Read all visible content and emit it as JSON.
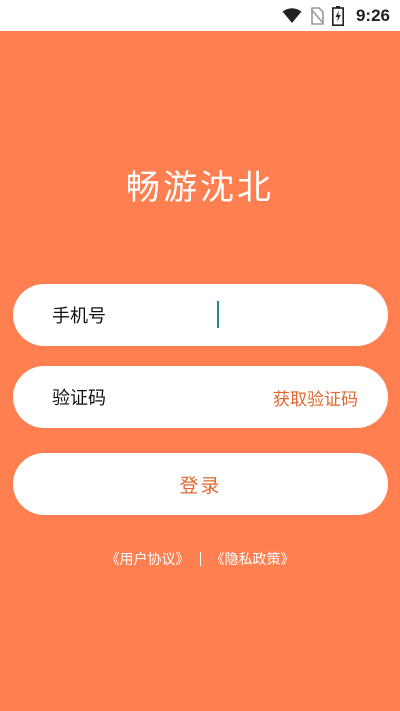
{
  "status_bar": {
    "time": "9:26",
    "icons": [
      "wifi-icon",
      "no-sim-icon",
      "battery-charging-icon"
    ]
  },
  "app": {
    "title": "畅游沈北"
  },
  "form": {
    "phone_label": "手机号",
    "code_label": "验证码",
    "get_code_label": "获取验证码",
    "login_label": "登录"
  },
  "links": {
    "user_agreement": "《用户协议》",
    "privacy_policy": "《隐私政策》"
  },
  "colors": {
    "background": "#ff7f50",
    "accent": "#e0672f",
    "cursor": "#1e8c8c"
  }
}
